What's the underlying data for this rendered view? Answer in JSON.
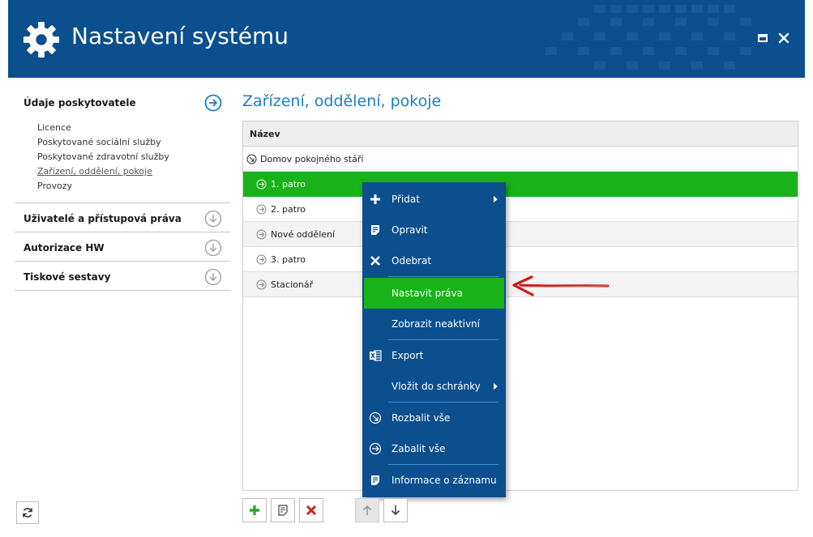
{
  "header": {
    "title": "Nastavení systému",
    "title_icon": "gear-icon",
    "buttons": [
      "maximize-icon",
      "close-icon"
    ],
    "background_color": "#0b4f8e"
  },
  "sidebar": {
    "sections": [
      {
        "label": "Údaje poskytovatele",
        "state": "expanded",
        "icon": "arrow-right-circle-icon",
        "items": [
          {
            "label": "Licence"
          },
          {
            "label": "Poskytované sociální služby"
          },
          {
            "label": "Poskytované zdravotní služby"
          },
          {
            "label": "Zařízení, oddělení, pokoje",
            "active": true
          },
          {
            "label": "Provozy"
          }
        ]
      },
      {
        "label": "Uživatelé a přístupová práva",
        "state": "collapsed",
        "icon": "arrow-down-circle-icon"
      },
      {
        "label": "Autorizace HW",
        "state": "collapsed",
        "icon": "arrow-down-circle-icon"
      },
      {
        "label": "Tiskové sestavy",
        "state": "collapsed",
        "icon": "arrow-down-circle-icon"
      }
    ]
  },
  "main": {
    "title": "Zařízení, oddělení, pokoje",
    "grid": {
      "column_header": "Název",
      "rows": [
        {
          "label": "Domov pokojného stáří",
          "level": 0,
          "icon": "collapse-circle-icon"
        },
        {
          "label": "1. patro",
          "level": 1,
          "icon": "expand-circle-icon",
          "selected": true
        },
        {
          "label": "2. patro",
          "level": 1,
          "icon": "expand-circle-icon"
        },
        {
          "label": "Nové oddělení",
          "level": 1,
          "icon": "expand-circle-icon"
        },
        {
          "label": "3. patro",
          "level": 1,
          "icon": "expand-circle-icon"
        },
        {
          "label": "Stacionář",
          "level": 1,
          "icon": "expand-circle-icon"
        }
      ]
    }
  },
  "context_menu": {
    "items": [
      {
        "label": "Přidat",
        "icon": "plus-icon",
        "submenu": true
      },
      {
        "label": "Opravit",
        "icon": "edit-icon"
      },
      {
        "label": "Odebrat",
        "icon": "x-icon"
      },
      {
        "label": "Nastavit práva",
        "icon": "",
        "highlighted": true
      },
      {
        "label": "Zobrazit neaktivní",
        "icon": ""
      },
      {
        "label": "Export",
        "icon": "excel-icon"
      },
      {
        "label": "Vložit do schránky",
        "icon": "",
        "submenu": true
      },
      {
        "label": "Rozbalit vše",
        "icon": "expand-circle-icon"
      },
      {
        "label": "Zabalit vše",
        "icon": "collapse-right-circle-icon"
      },
      {
        "label": "Informace o záznamu",
        "icon": "info-doc-icon"
      }
    ],
    "background_color": "#0b4f8e",
    "highlight_color": "#19b219"
  },
  "toolbar": {
    "buttons": [
      {
        "name": "add",
        "icon": "plus-icon",
        "color": "#2fa52f"
      },
      {
        "name": "edit",
        "icon": "edit-icon"
      },
      {
        "name": "delete",
        "icon": "x-icon",
        "color": "#d11a1a"
      },
      {
        "name": "move-up",
        "icon": "arrow-up-icon",
        "disabled": true
      },
      {
        "name": "move-down",
        "icon": "arrow-down-icon"
      }
    ],
    "refresh_icon": "refresh-icon"
  },
  "annotation": {
    "icon": "red-arrow-icon",
    "color": "#cc1a1a"
  },
  "colors": {
    "accent": "#1a7fc1",
    "selected_row": "#19b219"
  }
}
